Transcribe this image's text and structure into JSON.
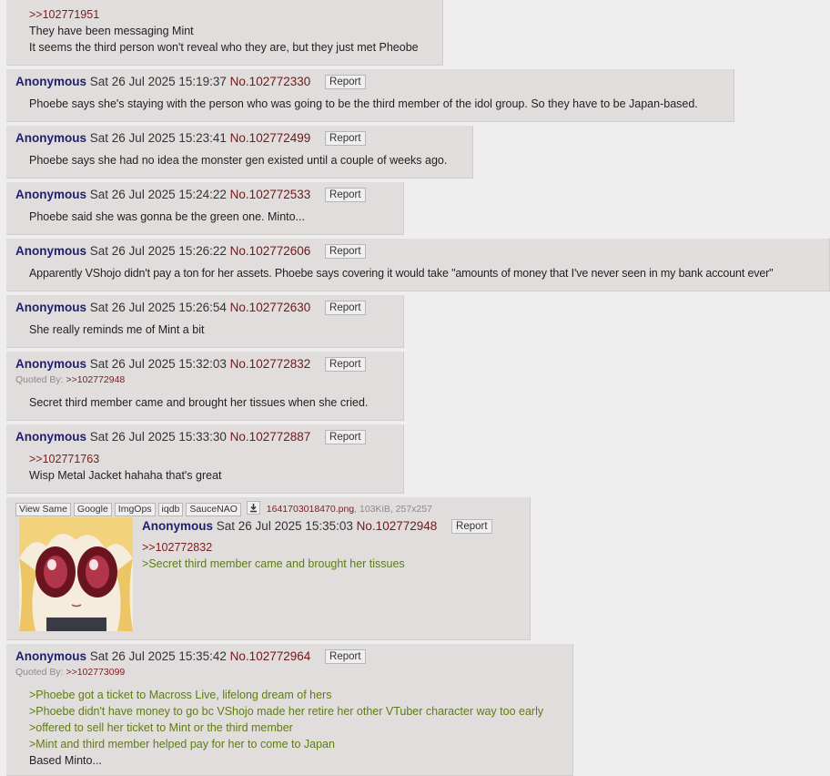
{
  "posts": [
    {
      "lines": [
        {
          "text": ">>102771951",
          "kind": "quotelink"
        },
        {
          "text": "They have been messaging Mint",
          "kind": "text"
        },
        {
          "text": "It seems the third person won't reveal who they are, but they just met Pheobe",
          "kind": "text"
        }
      ]
    },
    {
      "name": "Anonymous",
      "date": "Sat 26 Jul 2025 15:19:37",
      "no": "No.102772330",
      "report": "Report",
      "lines": [
        {
          "text": "Phoebe says she's staying with the person who was going to be the third member of the idol group. So they have to be Japan-based.",
          "kind": "text"
        }
      ]
    },
    {
      "name": "Anonymous",
      "date": "Sat 26 Jul 2025 15:23:41",
      "no": "No.102772499",
      "report": "Report",
      "lines": [
        {
          "text": "Phoebe says she had no idea the monster gen existed until a couple of weeks ago.",
          "kind": "text"
        }
      ]
    },
    {
      "name": "Anonymous",
      "date": "Sat 26 Jul 2025 15:24:22",
      "no": "No.102772533",
      "report": "Report",
      "lines": [
        {
          "text": "Phoebe said she was gonna be the green one. Minto...",
          "kind": "text"
        }
      ]
    },
    {
      "name": "Anonymous",
      "date": "Sat 26 Jul 2025 15:26:22",
      "no": "No.102772606",
      "report": "Report",
      "lines": [
        {
          "text": "Apparently VShojo didn't pay a ton for her assets. Phoebe says covering it would take \"amounts of money that I've never seen in my bank account ever\"",
          "kind": "text"
        }
      ]
    },
    {
      "name": "Anonymous",
      "date": "Sat 26 Jul 2025 15:26:54",
      "no": "No.102772630",
      "report": "Report",
      "lines": [
        {
          "text": "She really reminds me of Mint a bit",
          "kind": "text"
        }
      ]
    },
    {
      "name": "Anonymous",
      "date": "Sat 26 Jul 2025 15:32:03",
      "no": "No.102772832",
      "report": "Report",
      "quoted_label": "Quoted By:",
      "quoted_link": ">>102772948",
      "lines": [
        {
          "text": "Secret third member came and brought her tissues when she cried.",
          "kind": "text"
        }
      ]
    },
    {
      "name": "Anonymous",
      "date": "Sat 26 Jul 2025 15:33:30",
      "no": "No.102772887",
      "report": "Report",
      "lines": [
        {
          "text": ">>102771763",
          "kind": "quotelink"
        },
        {
          "text": "Wisp Metal Jacket hahaha that's great",
          "kind": "text"
        }
      ]
    },
    {
      "image_buttons": [
        "View Same",
        "Google",
        "ImgOps",
        "iqdb",
        "SauceNAO"
      ],
      "download_icon": "download-icon",
      "file_name": "1641703018470.png",
      "file_info": ", 103KiB, 257x257",
      "name": "Anonymous",
      "date": "Sat 26 Jul 2025 15:35:03",
      "no": "No.102772948",
      "report": "Report",
      "lines": [
        {
          "text": ">>102772832",
          "kind": "quotelink"
        },
        {
          "text": ">Secret third member came and brought her tissues",
          "kind": "greentext"
        }
      ]
    },
    {
      "name": "Anonymous",
      "date": "Sat 26 Jul 2025 15:35:42",
      "no": "No.102772964",
      "report": "Report",
      "quoted_label": "Quoted By:",
      "quoted_link": ">>102773099",
      "lines": [
        {
          "text": ">Phoebe got a ticket to Macross Live, lifelong dream of hers",
          "kind": "greentext"
        },
        {
          "text": ">Phoebe didn't have money to go bc VShojo made her retire her other VTuber character way too early",
          "kind": "greentext"
        },
        {
          "text": ">offered to sell her ticket to Mint or the third member",
          "kind": "greentext"
        },
        {
          "text": ">Mint and third member helped pay for her to come to Japan",
          "kind": "greentext"
        },
        {
          "text": "Based Minto...",
          "kind": "text"
        }
      ]
    }
  ],
  "colors": {
    "name": "#1f1f6e",
    "post_number": "#6e1a1a",
    "quotelink": "#7a1d1d",
    "greentext": "#5f7b14",
    "post_bg": "#e1dddc",
    "page_bg": "#eeeeee"
  }
}
